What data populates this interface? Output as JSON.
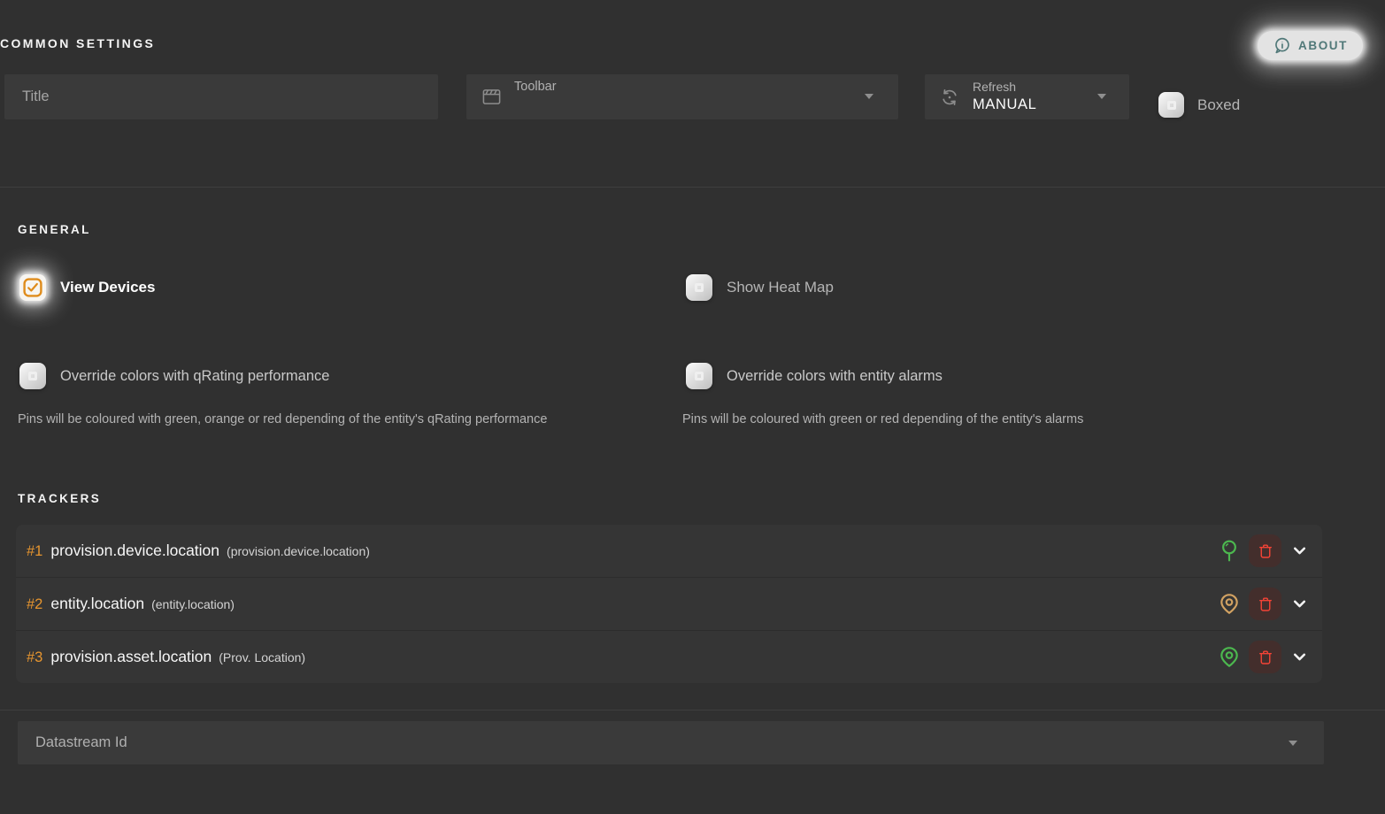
{
  "colors": {
    "accent_orange": "#e6952f",
    "check_orange": "#df8c1c",
    "pin_green": "#4cb84f",
    "pin_tan": "#d2a262",
    "trash_red": "#f44336",
    "about_teal": "#507878",
    "background": "#303030",
    "field_background": "#3a3a3a"
  },
  "common": {
    "heading": "COMMON SETTINGS",
    "about_label": "ABOUT",
    "title_placeholder": "Title",
    "toolbar_label": "Toolbar",
    "refresh_label": "Refresh",
    "refresh_value": "MANUAL",
    "boxed_label": "Boxed"
  },
  "general": {
    "heading": "GENERAL",
    "view_devices": {
      "label": "View Devices",
      "checked": true
    },
    "show_heat_map": {
      "label": "Show Heat Map",
      "checked": false
    },
    "override_qrating": {
      "label": "Override colors with qRating performance",
      "checked": false,
      "description": "Pins will be coloured with green, orange or red depending of the entity's qRating performance"
    },
    "override_alarms": {
      "label": "Override colors with entity alarms",
      "checked": false,
      "description": "Pins will be coloured with green or red depending of the entity's alarms"
    }
  },
  "trackers": {
    "heading": "TRACKERS",
    "items": [
      {
        "index": "#1",
        "name": "provision.device.location",
        "alias": "(provision.device.location)",
        "pin_icon": "pin-drop",
        "pin_color": "#4cb84f"
      },
      {
        "index": "#2",
        "name": "entity.location",
        "alias": "(entity.location)",
        "pin_icon": "location-marker",
        "pin_color": "#d2a262"
      },
      {
        "index": "#3",
        "name": "provision.asset.location",
        "alias": "(Prov. Location)",
        "pin_icon": "location-marker",
        "pin_color": "#4cb84f"
      }
    ]
  },
  "datastream": {
    "label": "Datastream Id"
  }
}
